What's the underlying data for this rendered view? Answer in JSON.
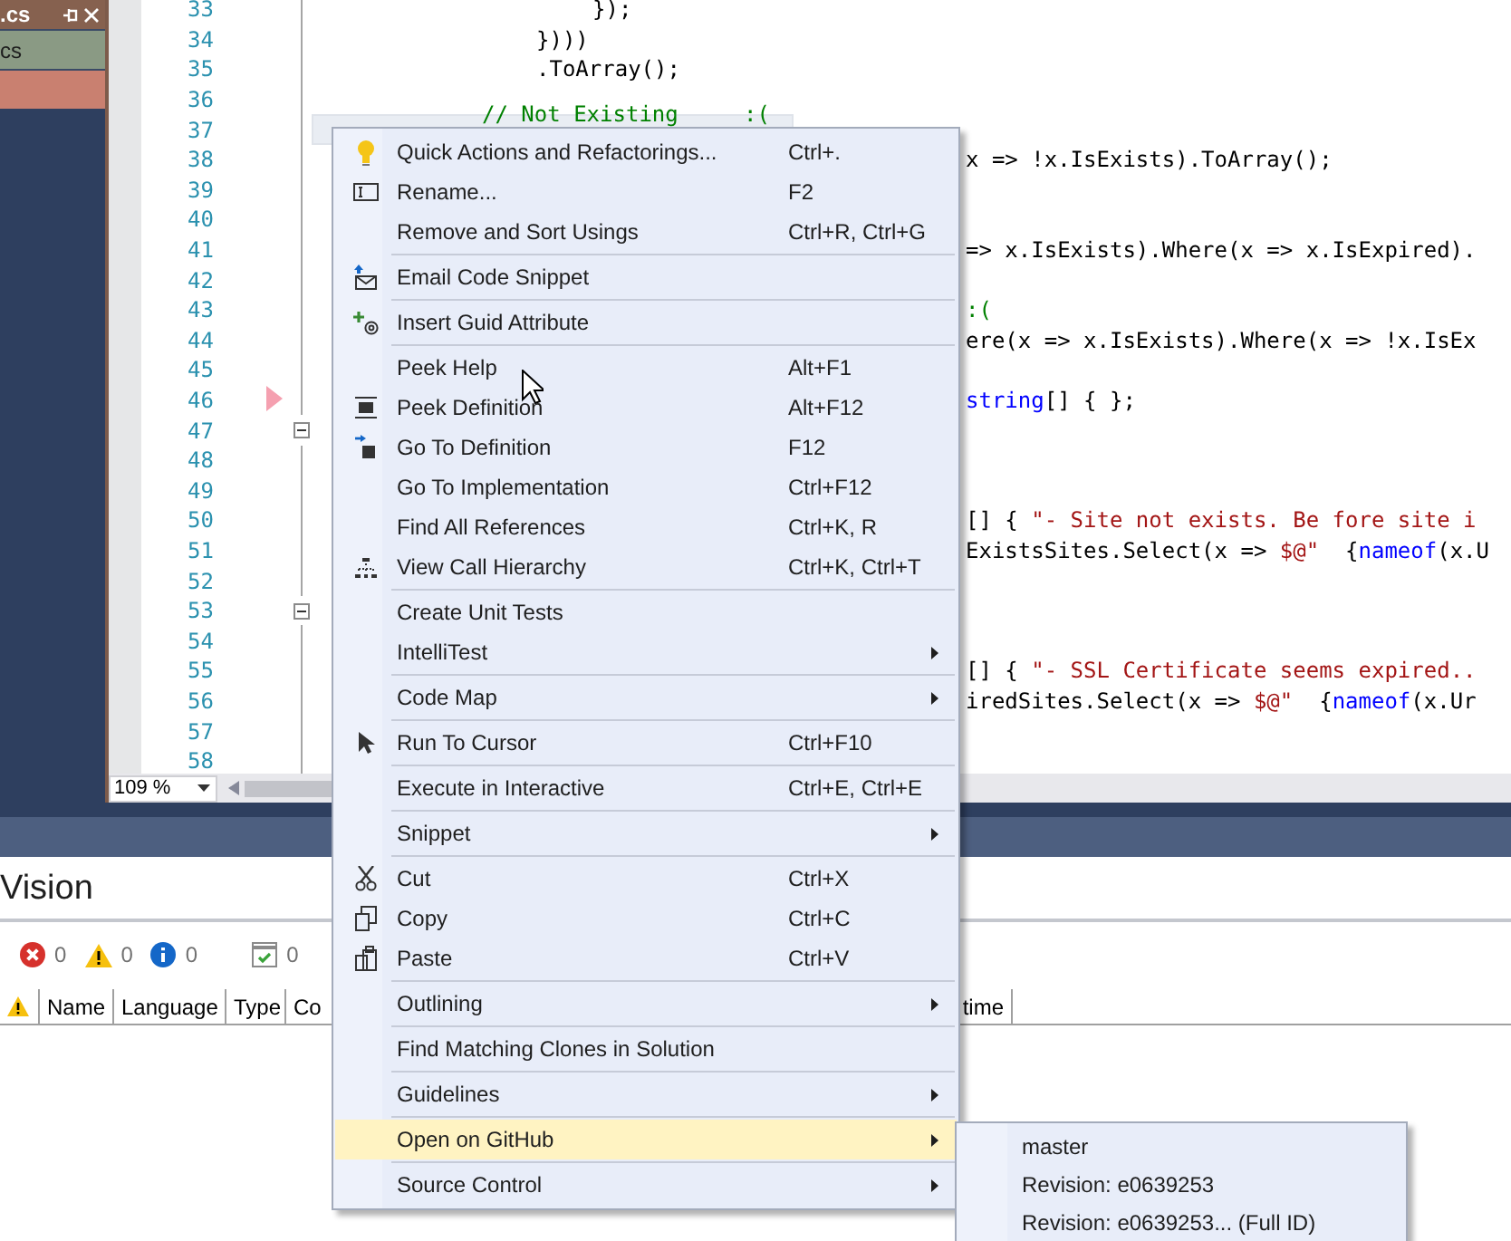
{
  "document_tab": {
    "title": ".cs"
  },
  "solution_rows": [
    {
      "label": "cs",
      "color": "#8a9a84"
    },
    {
      "color": "#c98070"
    }
  ],
  "editor": {
    "lines": [
      {
        "number": "33",
        "kind": "deep",
        "highlighted": false,
        "breakpoint": false,
        "collapsible": false,
        "tokens": [
          {
            "kind": "plain",
            "text": "});"
          }
        ]
      },
      {
        "number": "34",
        "kind": "inner",
        "highlighted": false,
        "breakpoint": false,
        "collapsible": false,
        "tokens": [
          {
            "kind": "plain",
            "text": "})))"
          }
        ]
      },
      {
        "number": "35",
        "kind": "inner",
        "highlighted": false,
        "breakpoint": false,
        "collapsible": false,
        "tokens": [
          {
            "kind": "plain",
            "text": ".ToArray();"
          }
        ]
      },
      {
        "number": "36",
        "highlighted": false,
        "breakpoint": false,
        "collapsible": false
      },
      {
        "number": "37",
        "kind": "comment",
        "highlighted": true,
        "breakpoint": false,
        "collapsible": false,
        "tokens": [
          {
            "kind": "comment",
            "text": "// Not Existing     :("
          }
        ]
      },
      {
        "number": "38",
        "kind": "clipped",
        "highlighted": false,
        "breakpoint": false,
        "collapsible": false,
        "tokens": [
          {
            "kind": "plain",
            "text": "x => !x.IsExists).ToArray();"
          }
        ]
      },
      {
        "number": "39",
        "highlighted": false,
        "breakpoint": false,
        "collapsible": false
      },
      {
        "number": "40",
        "highlighted": false,
        "breakpoint": false,
        "collapsible": false
      },
      {
        "number": "41",
        "kind": "clipped",
        "highlighted": false,
        "breakpoint": false,
        "collapsible": false,
        "tokens": [
          {
            "kind": "plain",
            "text": "=> x.IsExists).Where(x => x.IsExpired)."
          }
        ]
      },
      {
        "number": "42",
        "highlighted": false,
        "breakpoint": false,
        "collapsible": false
      },
      {
        "number": "43",
        "kind": "clipped",
        "highlighted": false,
        "breakpoint": false,
        "collapsible": false,
        "tokens": [
          {
            "kind": "comment",
            "text": ":("
          }
        ]
      },
      {
        "number": "44",
        "kind": "clipped",
        "highlighted": false,
        "breakpoint": false,
        "collapsible": false,
        "tokens": [
          {
            "kind": "plain",
            "text": "ere(x => x.IsExists).Where(x => !x.IsEx"
          }
        ]
      },
      {
        "number": "45",
        "highlighted": false,
        "breakpoint": false,
        "collapsible": false
      },
      {
        "number": "46",
        "kind": "clipped",
        "highlighted": false,
        "breakpoint": true,
        "collapsible": false,
        "tokens": [
          {
            "kind": "keyword",
            "text": "string"
          },
          {
            "kind": "plain",
            "text": "[] { };"
          }
        ]
      },
      {
        "number": "47",
        "highlighted": false,
        "breakpoint": false,
        "collapsible": true
      },
      {
        "number": "48",
        "highlighted": false,
        "breakpoint": false,
        "collapsible": false
      },
      {
        "number": "49",
        "highlighted": false,
        "breakpoint": false,
        "collapsible": false
      },
      {
        "number": "50",
        "kind": "clipped",
        "highlighted": false,
        "breakpoint": false,
        "collapsible": false,
        "tokens": [
          {
            "kind": "plain",
            "text": "[] { "
          },
          {
            "kind": "string",
            "text": "\"- Site not exists. Be fore site i"
          }
        ]
      },
      {
        "number": "51",
        "kind": "clipped",
        "highlighted": false,
        "breakpoint": false,
        "collapsible": false,
        "tokens": [
          {
            "kind": "plain",
            "text": "ExistsSites.Select(x => "
          },
          {
            "kind": "string",
            "text": "$@\"  "
          },
          {
            "kind": "plain",
            "text": "{"
          },
          {
            "kind": "keyword",
            "text": "nameof"
          },
          {
            "kind": "plain",
            "text": "(x.U"
          }
        ]
      },
      {
        "number": "52",
        "highlighted": false,
        "breakpoint": false,
        "collapsible": false
      },
      {
        "number": "53",
        "highlighted": false,
        "breakpoint": false,
        "collapsible": true
      },
      {
        "number": "54",
        "highlighted": false,
        "breakpoint": false,
        "collapsible": false
      },
      {
        "number": "55",
        "kind": "clipped",
        "highlighted": false,
        "breakpoint": false,
        "collapsible": false,
        "tokens": [
          {
            "kind": "plain",
            "text": "[] { "
          },
          {
            "kind": "string",
            "text": "\"- SSL Certificate seems expired.."
          }
        ]
      },
      {
        "number": "56",
        "kind": "clipped",
        "highlighted": false,
        "breakpoint": false,
        "collapsible": false,
        "tokens": [
          {
            "kind": "plain",
            "text": "iredSites.Select(x => "
          },
          {
            "kind": "string",
            "text": "$@\"  "
          },
          {
            "kind": "plain",
            "text": "{"
          },
          {
            "kind": "keyword",
            "text": "nameof"
          },
          {
            "kind": "plain",
            "text": "(x.Ur"
          }
        ]
      },
      {
        "number": "57",
        "highlighted": false,
        "breakpoint": false,
        "collapsible": false
      },
      {
        "number": "58",
        "highlighted": false,
        "breakpoint": false,
        "collapsible": false
      }
    ],
    "zoom": "109 %"
  },
  "bottom_panel": {
    "title": "Vision",
    "counters": [
      {
        "kind": "error",
        "count": "0"
      },
      {
        "kind": "warning",
        "count": "0"
      },
      {
        "kind": "info",
        "count": "0"
      },
      {
        "kind": "checks",
        "count": "0"
      }
    ],
    "columns": [
      {
        "kind": "icon"
      },
      {
        "kind": "text",
        "label": "Name"
      },
      {
        "kind": "text",
        "label": "Language"
      },
      {
        "kind": "text",
        "label": "Type"
      },
      {
        "kind": "text",
        "label": "Co"
      },
      {
        "kind": "text",
        "label": "time"
      },
      {
        "kind": "blank"
      }
    ]
  },
  "context_menu": {
    "items": [
      {
        "kind": "item",
        "label": "Quick Actions and Refactorings...",
        "shortcut": "Ctrl+.",
        "has_submenu": false,
        "selected": false
      },
      {
        "kind": "item",
        "label": "Rename...",
        "shortcut": "F2",
        "has_submenu": false,
        "selected": false
      },
      {
        "kind": "item",
        "label": "Remove and Sort Usings",
        "shortcut": "Ctrl+R, Ctrl+G",
        "has_submenu": false,
        "selected": false
      },
      {
        "kind": "separator"
      },
      {
        "kind": "item",
        "label": "Email Code Snippet",
        "has_submenu": false,
        "selected": false
      },
      {
        "kind": "separator"
      },
      {
        "kind": "item",
        "label": "Insert Guid Attribute",
        "has_submenu": false,
        "selected": false
      },
      {
        "kind": "separator"
      },
      {
        "kind": "item",
        "label": "Peek Help",
        "shortcut": "Alt+F1",
        "has_submenu": false,
        "selected": false
      },
      {
        "kind": "item",
        "label": "Peek Definition",
        "shortcut": "Alt+F12",
        "has_submenu": false,
        "selected": false
      },
      {
        "kind": "item",
        "label": "Go To Definition",
        "shortcut": "F12",
        "has_submenu": false,
        "selected": false
      },
      {
        "kind": "item",
        "label": "Go To Implementation",
        "shortcut": "Ctrl+F12",
        "has_submenu": false,
        "selected": false
      },
      {
        "kind": "item",
        "label": "Find All References",
        "shortcut": "Ctrl+K, R",
        "has_submenu": false,
        "selected": false
      },
      {
        "kind": "item",
        "label": "View Call Hierarchy",
        "shortcut": "Ctrl+K, Ctrl+T",
        "has_submenu": false,
        "selected": false
      },
      {
        "kind": "separator"
      },
      {
        "kind": "item",
        "label": "Create Unit Tests",
        "has_submenu": false,
        "selected": false
      },
      {
        "kind": "item",
        "label": "IntelliTest",
        "has_submenu": true,
        "selected": false
      },
      {
        "kind": "separator"
      },
      {
        "kind": "item",
        "label": "Code Map",
        "has_submenu": true,
        "selected": false
      },
      {
        "kind": "separator"
      },
      {
        "kind": "item",
        "label": "Run To Cursor",
        "shortcut": "Ctrl+F10",
        "has_submenu": false,
        "selected": false
      },
      {
        "kind": "separator"
      },
      {
        "kind": "item",
        "label": "Execute in Interactive",
        "shortcut": "Ctrl+E, Ctrl+E",
        "has_submenu": false,
        "selected": false
      },
      {
        "kind": "separator"
      },
      {
        "kind": "item",
        "label": "Snippet",
        "has_submenu": true,
        "selected": false
      },
      {
        "kind": "separator"
      },
      {
        "kind": "item",
        "label": "Cut",
        "shortcut": "Ctrl+X",
        "has_submenu": false,
        "selected": false
      },
      {
        "kind": "item",
        "label": "Copy",
        "shortcut": "Ctrl+C",
        "has_submenu": false,
        "selected": false
      },
      {
        "kind": "item",
        "label": "Paste",
        "shortcut": "Ctrl+V",
        "has_submenu": false,
        "selected": false
      },
      {
        "kind": "separator"
      },
      {
        "kind": "item",
        "label": "Outlining",
        "has_submenu": true,
        "selected": false
      },
      {
        "kind": "separator"
      },
      {
        "kind": "item",
        "label": "Find Matching Clones in Solution",
        "has_submenu": false,
        "selected": false
      },
      {
        "kind": "separator"
      },
      {
        "kind": "item",
        "label": "Guidelines",
        "has_submenu": true,
        "selected": false
      },
      {
        "kind": "separator"
      },
      {
        "kind": "item",
        "label": "Open on GitHub",
        "has_submenu": true,
        "selected": true,
        "open_submenu": [
          {
            "label": "master"
          },
          {
            "label": "Revision: e0639253"
          },
          {
            "label": "Revision: e0639253... (Full ID)"
          }
        ]
      },
      {
        "kind": "separator"
      },
      {
        "kind": "item",
        "label": "Source Control",
        "has_submenu": true,
        "selected": false
      }
    ]
  }
}
